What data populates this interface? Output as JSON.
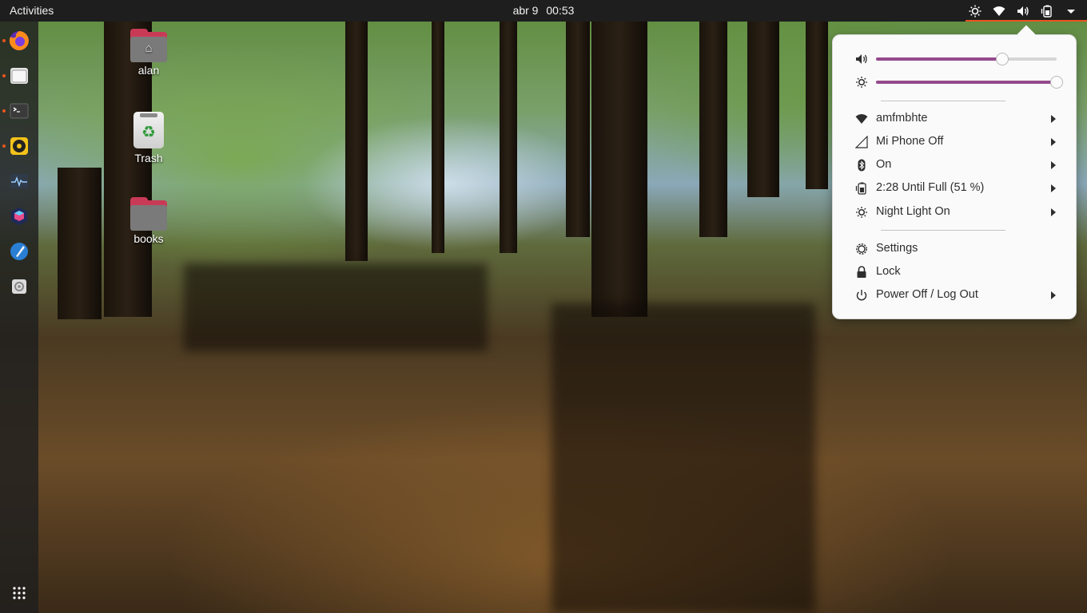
{
  "topbar": {
    "activities": "Activities",
    "date": "abr 9",
    "time": "00:53",
    "tray_icons": [
      "night-light-icon",
      "wifi-icon",
      "volume-icon",
      "battery-icon",
      "menu-caret-icon"
    ]
  },
  "dock": {
    "items": [
      {
        "name": "firefox",
        "running": true
      },
      {
        "name": "files",
        "running": true
      },
      {
        "name": "terminal",
        "running": true
      },
      {
        "name": "rhythmbox",
        "running": true
      },
      {
        "name": "system-monitor",
        "running": false
      },
      {
        "name": "cube-app",
        "running": false
      },
      {
        "name": "text-editor",
        "running": false
      },
      {
        "name": "settings",
        "running": false
      }
    ],
    "show_apps": "show-applications-icon"
  },
  "desktop": {
    "icons": [
      {
        "label": "alan",
        "type": "home-folder"
      },
      {
        "label": "Trash",
        "type": "trash"
      },
      {
        "label": "books",
        "type": "folder"
      }
    ]
  },
  "menu": {
    "volume_level": 0.7,
    "brightness_level": 1.0,
    "items": [
      {
        "label": "amfmbhte",
        "icon": "wifi-icon",
        "submenu": true
      },
      {
        "label": "Mi Phone Off",
        "icon": "signal-icon",
        "submenu": true
      },
      {
        "label": "On",
        "icon": "bluetooth-icon",
        "submenu": true
      },
      {
        "label": "2:28 Until Full (51 %)",
        "icon": "battery-icon",
        "submenu": true
      },
      {
        "label": "Night Light On",
        "icon": "night-light-icon",
        "submenu": true
      },
      {
        "label": "Settings",
        "icon": "settings-icon",
        "submenu": false
      },
      {
        "label": "Lock",
        "icon": "lock-icon",
        "submenu": false
      },
      {
        "label": "Power Off / Log Out",
        "icon": "power-icon",
        "submenu": true
      }
    ]
  },
  "colors": {
    "accent": "#934a8c",
    "ubuntu_orange": "#e95420",
    "folder": "#c93a56",
    "topbar": "#1e1e1e"
  }
}
